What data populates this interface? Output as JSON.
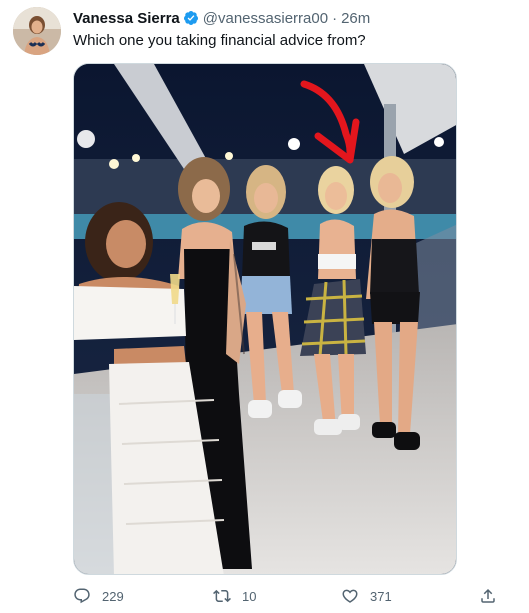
{
  "tweet": {
    "author_name": "Vanessa Sierra",
    "handle": "@vanessasierra00",
    "separator": "·",
    "time": "26m",
    "text": "Which one you taking financial advice from?",
    "avatar_icon": "profile-avatar",
    "verified_icon": "verified-badge-icon",
    "media_description_icon": "photo"
  },
  "actions": {
    "reply_count": "229",
    "retweet_count": "10",
    "like_count": "371",
    "reply_icon": "reply-icon",
    "retweet_icon": "retweet-icon",
    "like_icon": "heart-icon",
    "share_icon": "share-icon"
  },
  "colors": {
    "accent": "#1d9bf0",
    "muted_text": "#536471",
    "arrow_red": "#e3161d"
  }
}
